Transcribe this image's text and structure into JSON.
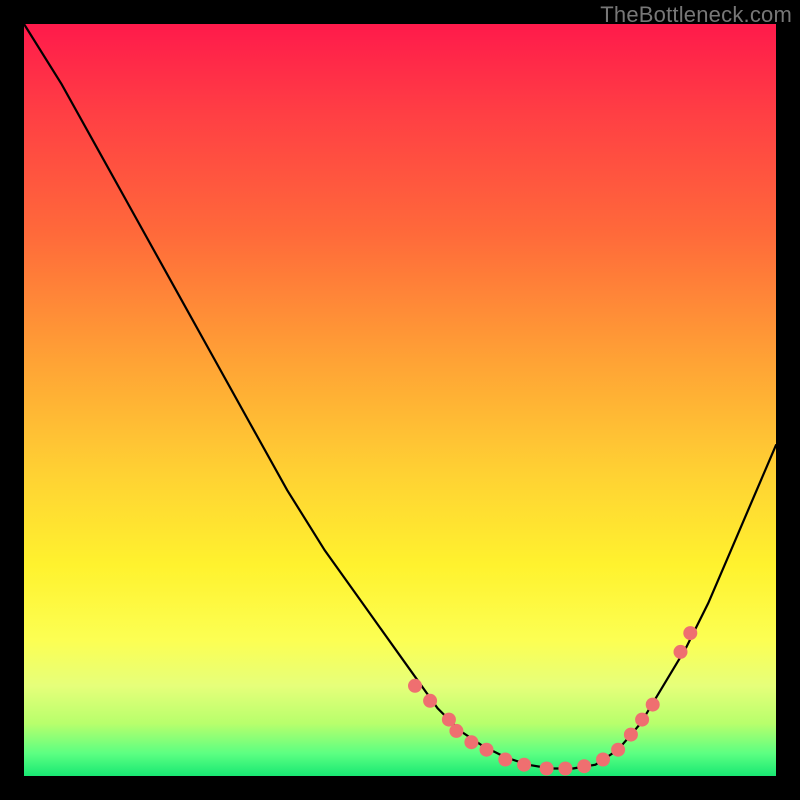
{
  "watermark": "TheBottleneck.com",
  "chart_data": {
    "type": "line",
    "title": "",
    "xlabel": "",
    "ylabel": "",
    "xlim": [
      0,
      1
    ],
    "ylim": [
      0,
      1
    ],
    "axes_visible": false,
    "grid": false,
    "background_gradient": {
      "stops": [
        {
          "pos": 0.0,
          "color": "#ff1a4b"
        },
        {
          "pos": 0.12,
          "color": "#ff3f44"
        },
        {
          "pos": 0.28,
          "color": "#ff6a3a"
        },
        {
          "pos": 0.45,
          "color": "#ffa335"
        },
        {
          "pos": 0.6,
          "color": "#ffd233"
        },
        {
          "pos": 0.72,
          "color": "#fff22e"
        },
        {
          "pos": 0.82,
          "color": "#fcff53"
        },
        {
          "pos": 0.88,
          "color": "#e6ff7a"
        },
        {
          "pos": 0.93,
          "color": "#b8ff6c"
        },
        {
          "pos": 0.97,
          "color": "#5cff82"
        },
        {
          "pos": 1.0,
          "color": "#18e873"
        }
      ]
    },
    "series": [
      {
        "name": "bottleneck-curve",
        "x": [
          0.0,
          0.05,
          0.1,
          0.15,
          0.2,
          0.25,
          0.3,
          0.35,
          0.4,
          0.45,
          0.5,
          0.55,
          0.58,
          0.61,
          0.64,
          0.67,
          0.7,
          0.73,
          0.76,
          0.79,
          0.82,
          0.85,
          0.88,
          0.91,
          0.94,
          0.97,
          1.0
        ],
        "y": [
          1.0,
          0.92,
          0.83,
          0.74,
          0.65,
          0.56,
          0.47,
          0.38,
          0.3,
          0.23,
          0.16,
          0.09,
          0.06,
          0.04,
          0.025,
          0.015,
          0.01,
          0.01,
          0.015,
          0.035,
          0.07,
          0.12,
          0.17,
          0.23,
          0.3,
          0.37,
          0.44
        ]
      }
    ],
    "markers": {
      "name": "highlight-dots",
      "color": "#ef6f70",
      "radius_px": 7,
      "points": [
        {
          "x": 0.52,
          "y": 0.12
        },
        {
          "x": 0.54,
          "y": 0.1
        },
        {
          "x": 0.565,
          "y": 0.075
        },
        {
          "x": 0.575,
          "y": 0.06
        },
        {
          "x": 0.595,
          "y": 0.045
        },
        {
          "x": 0.615,
          "y": 0.035
        },
        {
          "x": 0.64,
          "y": 0.022
        },
        {
          "x": 0.665,
          "y": 0.015
        },
        {
          "x": 0.695,
          "y": 0.01
        },
        {
          "x": 0.72,
          "y": 0.01
        },
        {
          "x": 0.745,
          "y": 0.013
        },
        {
          "x": 0.77,
          "y": 0.022
        },
        {
          "x": 0.79,
          "y": 0.035
        },
        {
          "x": 0.807,
          "y": 0.055
        },
        {
          "x": 0.822,
          "y": 0.075
        },
        {
          "x": 0.836,
          "y": 0.095
        },
        {
          "x": 0.873,
          "y": 0.165
        },
        {
          "x": 0.886,
          "y": 0.19
        }
      ]
    }
  }
}
